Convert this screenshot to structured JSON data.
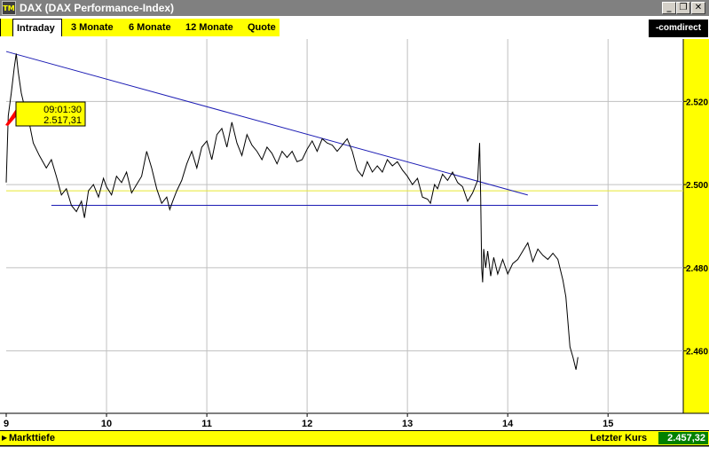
{
  "window": {
    "title": "DAX (DAX Performance-Index)",
    "app_icon_text": "TM",
    "buttons": {
      "minimize": "_",
      "restore": "❐",
      "close": "✕"
    }
  },
  "tabs": [
    {
      "label": "Intraday",
      "active": true
    },
    {
      "label": "3 Monate",
      "active": false
    },
    {
      "label": "6 Monate",
      "active": false
    },
    {
      "label": "12 Monate",
      "active": false
    },
    {
      "label": "Quote",
      "active": false
    }
  ],
  "brand": {
    "logo_text": "-comdirect"
  },
  "tooltip": {
    "time": "09:01:30",
    "value": "2.517,31"
  },
  "statusbar": {
    "left_label": "Markttiefe",
    "right_label": "Letzter Kurs",
    "last_price": "2.457,32"
  },
  "colors": {
    "accent_yellow": "#ffff00",
    "trendline_blue": "#1c1cb4",
    "price_line": "#000000",
    "last_price_bg": "#008000",
    "reference_line": "#e6e632"
  },
  "chart_data": {
    "type": "line",
    "title": "",
    "xlabel": "",
    "ylabel": "",
    "x_ticks": [
      "9",
      "10",
      "11",
      "12",
      "13",
      "14",
      "15"
    ],
    "y_ticks": [
      "2.460",
      "2.480",
      "2.500",
      "2.520"
    ],
    "xlim": [
      9,
      15.75
    ],
    "ylim": [
      2445,
      2535
    ],
    "grid": true,
    "reference_line": {
      "y": 2498.5
    },
    "trendlines": [
      {
        "x": [
          9.0,
          14.2
        ],
        "y": [
          2532.0,
          2497.5
        ]
      },
      {
        "x": [
          9.45,
          14.9
        ],
        "y": [
          2495.0,
          2495.0
        ]
      }
    ],
    "series": [
      {
        "x": [
          9.0,
          9.02,
          9.05,
          9.08,
          9.1,
          9.12,
          9.15,
          9.18,
          9.22,
          9.27,
          9.33,
          9.4,
          9.45,
          9.5,
          9.55,
          9.6,
          9.65,
          9.7,
          9.75,
          9.78,
          9.82,
          9.87,
          9.92,
          9.97,
          10.0,
          10.05,
          10.1,
          10.15,
          10.2,
          10.25,
          10.3,
          10.35,
          10.4,
          10.45,
          10.5,
          10.55,
          10.6,
          10.63,
          10.66,
          10.7,
          10.75,
          10.8,
          10.85,
          10.9,
          10.95,
          11.0,
          11.05,
          11.1,
          11.15,
          11.2,
          11.25,
          11.3,
          11.35,
          11.4,
          11.45,
          11.5,
          11.55,
          11.6,
          11.65,
          11.7,
          11.75,
          11.8,
          11.85,
          11.9,
          11.95,
          12.0,
          12.05,
          12.1,
          12.15,
          12.2,
          12.25,
          12.3,
          12.35,
          12.4,
          12.45,
          12.5,
          12.55,
          12.6,
          12.65,
          12.7,
          12.75,
          12.8,
          12.85,
          12.9,
          12.95,
          13.0,
          13.05,
          13.1,
          13.15,
          13.2,
          13.23,
          13.27,
          13.3,
          13.35,
          13.4,
          13.45,
          13.5,
          13.55,
          13.6,
          13.65,
          13.7,
          13.72,
          13.73,
          13.74,
          13.75,
          13.76,
          13.78,
          13.8,
          13.83,
          13.86,
          13.9,
          13.95,
          14.0,
          14.05,
          14.1,
          14.15,
          14.2,
          14.25,
          14.3,
          14.35,
          14.4,
          14.45,
          14.5,
          14.55,
          14.58,
          14.6,
          14.62,
          14.65,
          14.68,
          14.7
        ],
        "y": [
          2500.5,
          2516.5,
          2522.0,
          2528.0,
          2531.5,
          2527.0,
          2522.0,
          2519.0,
          2516.0,
          2510.0,
          2507.0,
          2504.0,
          2506.0,
          2502.0,
          2497.5,
          2499.0,
          2495.0,
          2493.5,
          2496.0,
          2492.0,
          2498.5,
          2500.0,
          2497.0,
          2501.5,
          2499.5,
          2497.5,
          2502.0,
          2500.5,
          2503.0,
          2498.0,
          2500.0,
          2502.0,
          2508.0,
          2504.0,
          2499.0,
          2495.5,
          2497.0,
          2494.0,
          2496.0,
          2498.5,
          2501.0,
          2505.0,
          2508.0,
          2504.0,
          2509.0,
          2510.5,
          2506.0,
          2512.0,
          2513.5,
          2509.0,
          2515.0,
          2510.0,
          2507.0,
          2512.0,
          2509.5,
          2508.0,
          2506.0,
          2509.0,
          2507.5,
          2505.0,
          2508.0,
          2506.5,
          2508.0,
          2505.5,
          2506.0,
          2508.5,
          2510.5,
          2508.0,
          2511.0,
          2510.0,
          2509.5,
          2508.0,
          2509.5,
          2511.0,
          2508.0,
          2503.5,
          2502.0,
          2505.5,
          2503.0,
          2504.5,
          2503.0,
          2506.0,
          2504.5,
          2505.5,
          2503.5,
          2502.0,
          2500.0,
          2501.5,
          2497.0,
          2496.5,
          2495.5,
          2500.0,
          2499.0,
          2502.5,
          2501.0,
          2503.0,
          2500.5,
          2499.5,
          2496.0,
          2498.0,
          2501.0,
          2510.0,
          2497.0,
          2480.0,
          2476.5,
          2484.5,
          2480.0,
          2484.0,
          2478.0,
          2482.5,
          2478.5,
          2482.0,
          2478.5,
          2481.0,
          2482.0,
          2484.0,
          2486.0,
          2481.5,
          2484.5,
          2483.0,
          2482.0,
          2483.5,
          2482.0,
          2477.0,
          2473.0,
          2467.0,
          2461.0,
          2458.5,
          2455.5,
          2458.5
        ]
      }
    ]
  }
}
